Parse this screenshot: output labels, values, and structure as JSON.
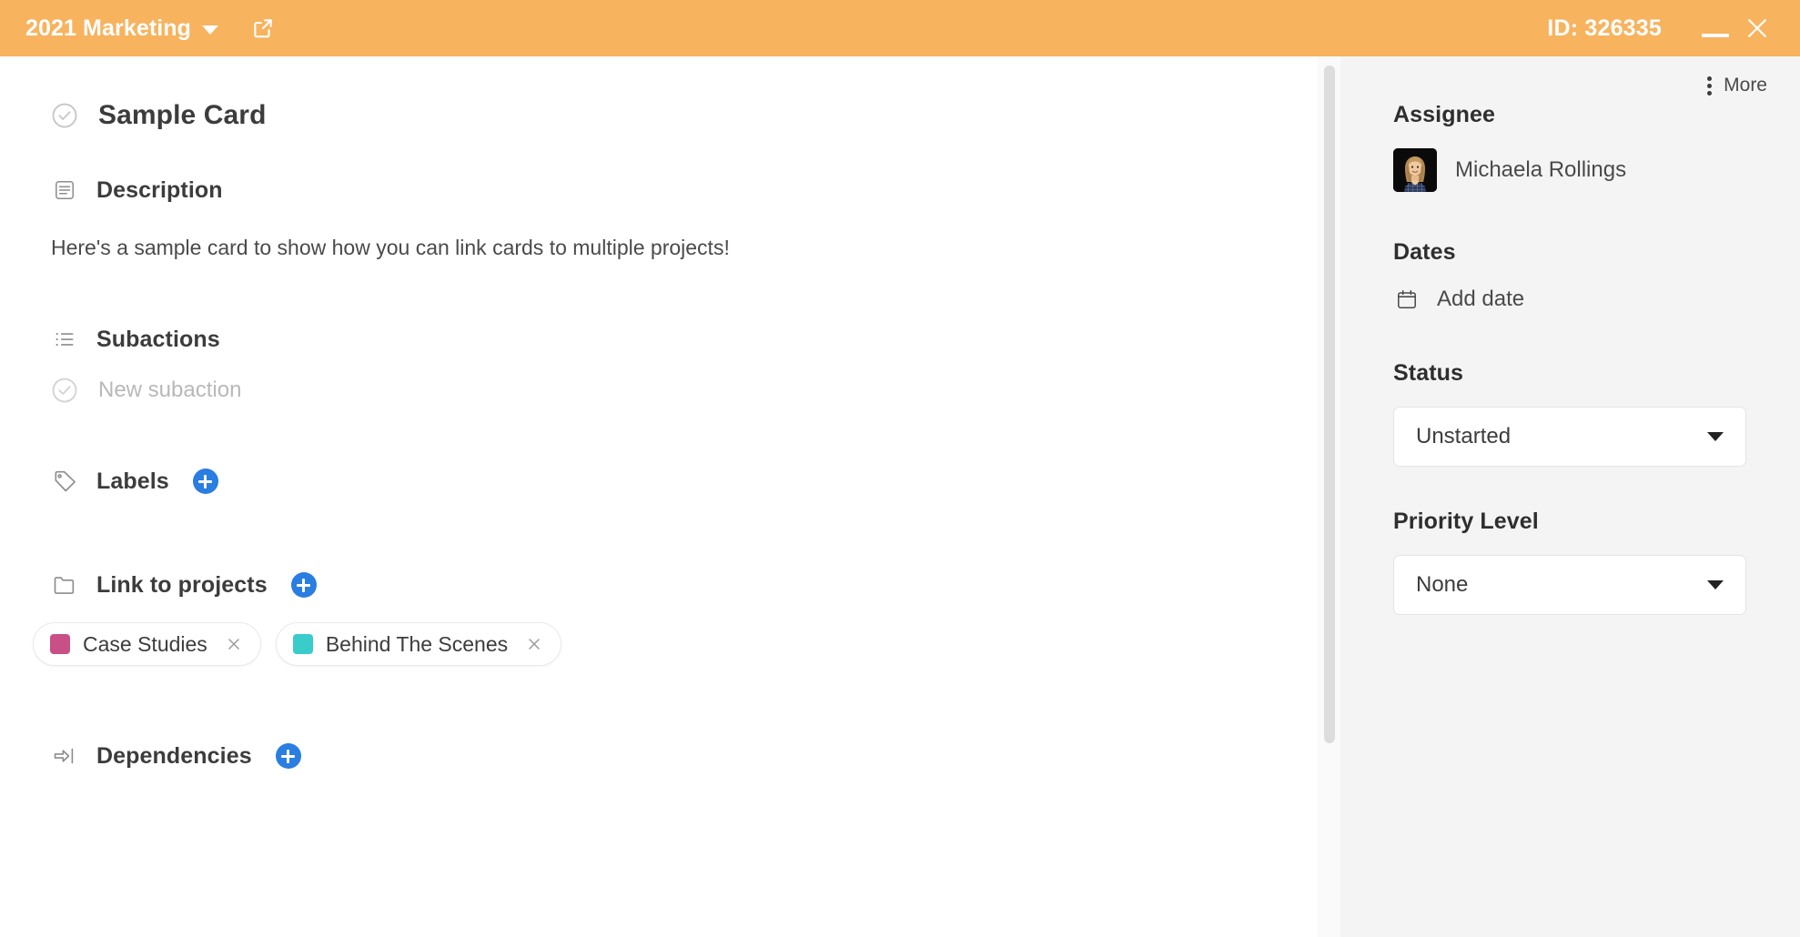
{
  "titlebar": {
    "board_name": "2021 Marketing",
    "dropdown_icon": "chevron-down-icon",
    "open_external_icon": "external-link-icon",
    "card_id": "ID: 326335",
    "minimize_label": "Minimize",
    "close_label": "Close",
    "background_color": "#f7b35e",
    "text_color": "#ffffff"
  },
  "card": {
    "complete_icon": "circle-check-icon",
    "title": "Sample Card"
  },
  "description": {
    "icon": "document-lines-icon",
    "heading": "Description",
    "text": "Here's a sample card to show how you can link cards to multiple projects!"
  },
  "subactions": {
    "icon": "bullet-list-icon",
    "heading": "Subactions",
    "new_item_icon": "circle-check-icon",
    "new_item_placeholder": "New subaction"
  },
  "labels": {
    "icon": "tag-icon",
    "heading": "Labels",
    "add_icon": "plus-circle-icon"
  },
  "link_to_projects": {
    "icon": "folder-icon",
    "heading": "Link to projects",
    "add_icon": "plus-circle-icon",
    "chips": [
      {
        "label": "Case Studies",
        "color": "#c94f87",
        "remove_icon": "close-icon"
      },
      {
        "label": "Behind The Scenes",
        "color": "#3acbcb",
        "remove_icon": "close-icon"
      }
    ]
  },
  "dependencies": {
    "icon": "arrow-to-bar-icon",
    "heading": "Dependencies",
    "add_icon": "plus-circle-icon"
  },
  "sidebar": {
    "more": {
      "icon": "vertical-dots-icon",
      "label": "More"
    },
    "assignee": {
      "heading": "Assignee",
      "avatar_icon": "user-avatar-photo",
      "name": "Michaela Rollings"
    },
    "dates": {
      "heading": "Dates",
      "icon": "calendar-icon",
      "add_label": "Add date"
    },
    "status": {
      "heading": "Status",
      "value": "Unstarted",
      "caret_icon": "chevron-down-icon"
    },
    "priority": {
      "heading": "Priority Level",
      "value": "None",
      "caret_icon": "chevron-down-icon"
    }
  },
  "theme": {
    "accent_blue": "#2a7de1",
    "header_orange": "#f7b35e",
    "sidebar_bg": "#f4f4f4"
  }
}
